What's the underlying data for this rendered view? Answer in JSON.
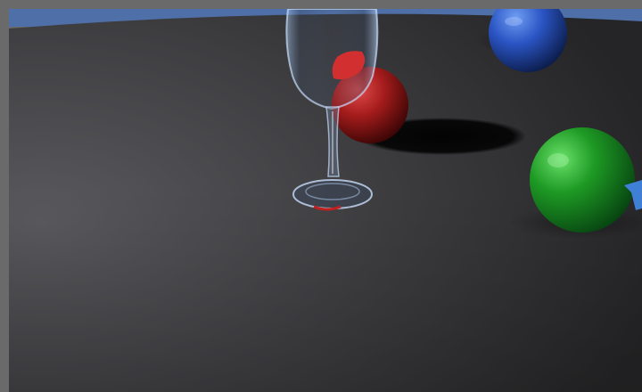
{
  "scene": {
    "objects": [
      {
        "name": "wine-glass",
        "material": "glass"
      },
      {
        "name": "red-sphere",
        "color": "#b32222"
      },
      {
        "name": "blue-sphere",
        "color": "#2a5ad0"
      },
      {
        "name": "green-sphere",
        "color": "#1faa2a"
      },
      {
        "name": "blue-object-partial",
        "color": "#3f7fd6"
      }
    ],
    "colors": {
      "frame": "#6a6a6a",
      "sky_horizon": "#4f6fa8",
      "floor_light": "#545458",
      "floor_dark": "#2a2a2c"
    }
  }
}
